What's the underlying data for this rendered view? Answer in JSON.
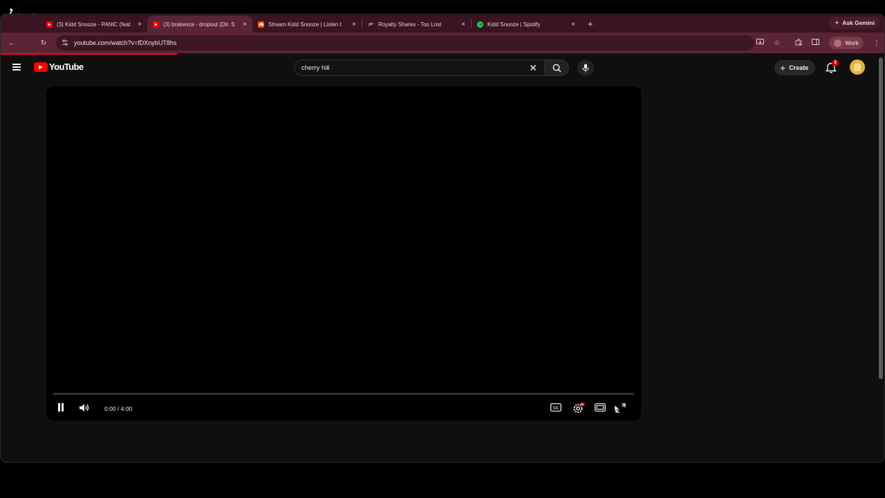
{
  "browser": {
    "tabs": [
      {
        "title": "(3) Kidd Snooze - PANIC (feat",
        "favicon": "youtube-icon",
        "active": false
      },
      {
        "title": "(3) brakence - dropout (Dir. S",
        "favicon": "youtube-icon",
        "active": true
      },
      {
        "title": "Stream Kidd Snooze | Listen t",
        "favicon": "soundcloud-icon",
        "active": false
      },
      {
        "title": "Royalty Shares - Too Lost",
        "favicon": "toolost-icon",
        "active": false
      },
      {
        "title": "Kidd Snooze | Spotify",
        "favicon": "spotify-icon",
        "active": false
      }
    ],
    "ask_gemini": "Ask Gemini",
    "url": "youtube.com/watch?v=fDXnybUT8hs",
    "profile": "Work"
  },
  "youtube": {
    "logo": "YouTube",
    "search_query": "cherry hill",
    "create_label": "Create",
    "notification_count": "3"
  },
  "player": {
    "time_display": "0:00 / 4:00",
    "progress": 0,
    "state": "playing"
  },
  "colors": {
    "tabstrip": "#3a1420",
    "toolbar": "#5a2434",
    "youtube_red": "#ff0000",
    "page_bg": "#0f0f0f"
  }
}
